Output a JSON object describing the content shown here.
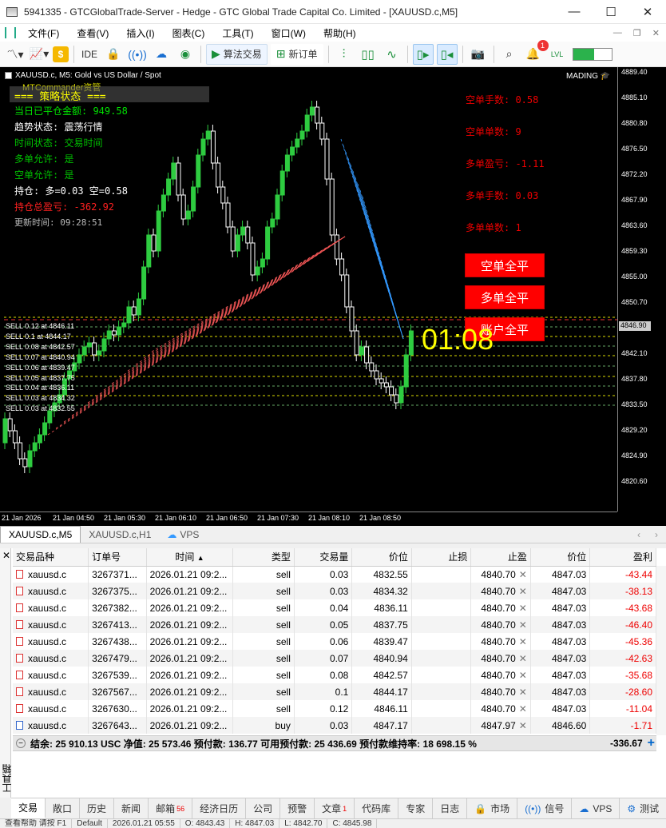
{
  "window": {
    "title": "5941335 - GTCGlobalTrade-Server - Hedge - GTC Global Trade Capital Co. Limited - [XAUUSD.c,M5]"
  },
  "menu": [
    "文件(F)",
    "查看(V)",
    "插入(I)",
    "图表(C)",
    "工具(T)",
    "窗口(W)",
    "帮助(H)"
  ],
  "toolbar": {
    "algo_trading": "算法交易",
    "new_order": "新订单",
    "ide": "IDE",
    "lvl": "LVL",
    "notif_count": "1",
    "progress_fraction": 0.55
  },
  "chart": {
    "header": "XAUUSD.c, M5:  Gold vs US Dollar / Spot",
    "indicator": "MTCommander资管",
    "mading": "MADING",
    "status_title": "=== 策略状态 ===",
    "lines_left": [
      {
        "text": "当日已平仓金额: 949.58",
        "color": "#00e000"
      },
      {
        "text": "趋势状态: 震荡行情",
        "color": "#ffffff"
      },
      {
        "text": "时间状态: 交易时间",
        "color": "#00c000"
      },
      {
        "text": "多单允许: 是",
        "color": "#00c000"
      },
      {
        "text": "空单允许: 是",
        "color": "#00c000"
      },
      {
        "text": "持仓: 多=0.03 空=0.58",
        "color": "#ffffff"
      },
      {
        "text": "持仓总盈亏: -362.92",
        "color": "#ff2020"
      },
      {
        "text": "更新时间: 09:28:51",
        "color": "#bbbbbb"
      }
    ],
    "lines_right": [
      "空单手数: 0.58",
      "空单单数: 9",
      "多单盈亏: -1.11",
      "多单手数: 0.03",
      "多单单数: 1"
    ],
    "buttons": [
      "空单全平",
      "多单全平",
      "账户全平"
    ],
    "timer": "01:08",
    "price_ticks": [
      "4889.40",
      "4885.10",
      "4880.80",
      "4876.50",
      "4872.20",
      "4867.90",
      "4863.60",
      "4859.30",
      "4855.00",
      "4850.70",
      "4846.40",
      "4842.10",
      "4837.80",
      "4833.50",
      "4829.20",
      "4824.90",
      "4820.60"
    ],
    "current_price": "4846.90",
    "time_ticks": [
      "21 Jan 2026",
      "21 Jan 04:50",
      "21 Jan 05:30",
      "21 Jan 06:10",
      "21 Jan 06:50",
      "21 Jan 07:30",
      "21 Jan 08:10",
      "21 Jan 08:50"
    ],
    "sell_labels": [
      "SELL 0.12 at 4846.11",
      "SELL 0.1 at 4844.17",
      "SELL 0.08 at 4842.57",
      "SELL 0.07 at 4840.94",
      "SELL 0.06 at 4839.47",
      "SELL 0.05 at 4837.75",
      "SELL 0.04 at 4836.11",
      "SELL 0.03 at 4834.32",
      "SELL 0.03 at 4832.55"
    ]
  },
  "chart_tabs": [
    "XAUUSD.c,M5",
    "XAUUSD.c,H1",
    "VPS"
  ],
  "terminal": {
    "side_title": "工具箱",
    "columns": [
      "交易品种",
      "订单号",
      "时间",
      "类型",
      "交易量",
      "价位",
      "止损",
      "止盈",
      "价位",
      "盈利"
    ],
    "rows": [
      {
        "symbol": "xauusd.c",
        "ticket": "3267371...",
        "time": "2026.01.21 09:2...",
        "type": "sell",
        "volume": "0.03",
        "price": "4832.55",
        "sl": "",
        "tp": "4840.70",
        "cur": "4847.03",
        "profit": "-43.44"
      },
      {
        "symbol": "xauusd.c",
        "ticket": "3267375...",
        "time": "2026.01.21 09:2...",
        "type": "sell",
        "volume": "0.03",
        "price": "4834.32",
        "sl": "",
        "tp": "4840.70",
        "cur": "4847.03",
        "profit": "-38.13"
      },
      {
        "symbol": "xauusd.c",
        "ticket": "3267382...",
        "time": "2026.01.21 09:2...",
        "type": "sell",
        "volume": "0.04",
        "price": "4836.11",
        "sl": "",
        "tp": "4840.70",
        "cur": "4847.03",
        "profit": "-43.68"
      },
      {
        "symbol": "xauusd.c",
        "ticket": "3267413...",
        "time": "2026.01.21 09:2...",
        "type": "sell",
        "volume": "0.05",
        "price": "4837.75",
        "sl": "",
        "tp": "4840.70",
        "cur": "4847.03",
        "profit": "-46.40"
      },
      {
        "symbol": "xauusd.c",
        "ticket": "3267438...",
        "time": "2026.01.21 09:2...",
        "type": "sell",
        "volume": "0.06",
        "price": "4839.47",
        "sl": "",
        "tp": "4840.70",
        "cur": "4847.03",
        "profit": "-45.36"
      },
      {
        "symbol": "xauusd.c",
        "ticket": "3267479...",
        "time": "2026.01.21 09:2...",
        "type": "sell",
        "volume": "0.07",
        "price": "4840.94",
        "sl": "",
        "tp": "4840.70",
        "cur": "4847.03",
        "profit": "-42.63"
      },
      {
        "symbol": "xauusd.c",
        "ticket": "3267539...",
        "time": "2026.01.21 09:2...",
        "type": "sell",
        "volume": "0.08",
        "price": "4842.57",
        "sl": "",
        "tp": "4840.70",
        "cur": "4847.03",
        "profit": "-35.68"
      },
      {
        "symbol": "xauusd.c",
        "ticket": "3267567...",
        "time": "2026.01.21 09:2...",
        "type": "sell",
        "volume": "0.1",
        "price": "4844.17",
        "sl": "",
        "tp": "4840.70",
        "cur": "4847.03",
        "profit": "-28.60"
      },
      {
        "symbol": "xauusd.c",
        "ticket": "3267630...",
        "time": "2026.01.21 09:2...",
        "type": "sell",
        "volume": "0.12",
        "price": "4846.11",
        "sl": "",
        "tp": "4840.70",
        "cur": "4847.03",
        "profit": "-11.04"
      },
      {
        "symbol": "xauusd.c",
        "ticket": "3267643...",
        "time": "2026.01.21 09:2...",
        "type": "buy",
        "volume": "0.03",
        "price": "4847.17",
        "sl": "",
        "tp": "4847.97",
        "cur": "4846.60",
        "profit": "-1.71"
      }
    ],
    "summary": "结余: 25 910.13 USC  净值: 25 573.46  预付款: 136.77  可用预付款: 25 436.69  预付款维持率: 18 698.15 %",
    "total": "-336.67"
  },
  "bottom_tabs": [
    {
      "label": "交易",
      "badge": ""
    },
    {
      "label": "敞口",
      "badge": ""
    },
    {
      "label": "历史",
      "badge": ""
    },
    {
      "label": "新闻",
      "badge": ""
    },
    {
      "label": "邮箱",
      "badge": "56"
    },
    {
      "label": "经济日历",
      "badge": ""
    },
    {
      "label": "公司",
      "badge": ""
    },
    {
      "label": "预警",
      "badge": ""
    },
    {
      "label": "文章",
      "badge": "1"
    },
    {
      "label": "代码库",
      "badge": ""
    },
    {
      "label": "专家",
      "badge": ""
    },
    {
      "label": "日志",
      "badge": ""
    }
  ],
  "bottom_right_tabs": [
    "市场",
    "信号",
    "VPS",
    "测试"
  ],
  "statusbar": [
    "查看帮助 请按 F1",
    "Default",
    "2026.01.21 05:55",
    "O: 4843.43",
    "H: 4847.03",
    "L: 4842.70",
    "C: 4845.98"
  ]
}
